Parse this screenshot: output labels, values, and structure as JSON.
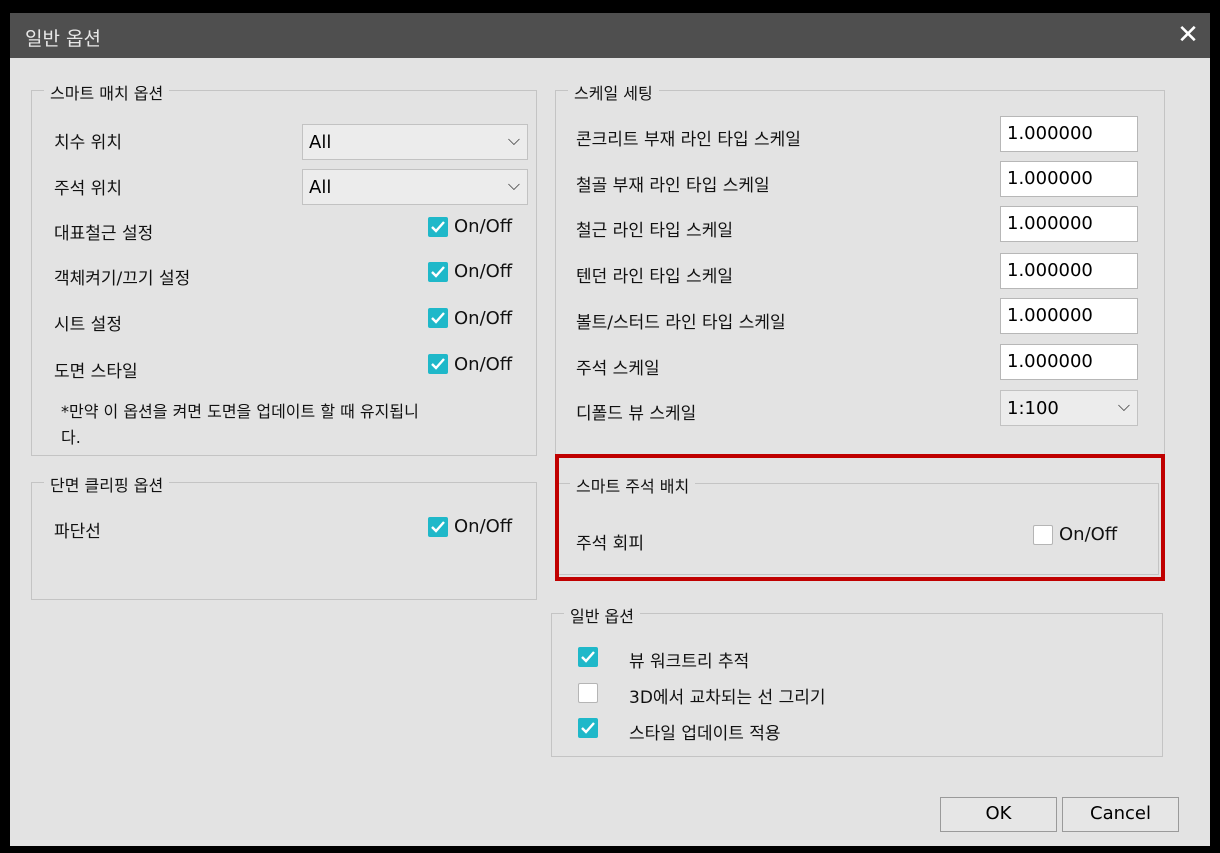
{
  "window": {
    "title": "일반 옵션",
    "close_glyph": "✕"
  },
  "smart_match": {
    "legend": "스마트 매치 옵션",
    "dim_position": {
      "label": "치수 위치",
      "value": "All"
    },
    "note_position": {
      "label": "주석 위치",
      "value": "All"
    },
    "toggles": [
      {
        "label": "대표철근 설정",
        "text": "On/Off",
        "checked": true
      },
      {
        "label": "객체켜기/끄기 설정",
        "text": "On/Off",
        "checked": true
      },
      {
        "label": "시트 설정",
        "text": "On/Off",
        "checked": true
      },
      {
        "label": "도면 스타일",
        "text": "On/Off",
        "checked": true
      }
    ],
    "note_line1": "*만약 이 옵션을 켜면 도면을 업데이트 할 때 유지됩니",
    "note_line2": "다."
  },
  "section_clip": {
    "legend": "단면 클리핑 옵션",
    "toggle": {
      "label": "파단선",
      "text": "On/Off",
      "checked": true
    }
  },
  "scale": {
    "legend": "스케일 세팅",
    "rows": [
      {
        "label": "콘크리트 부재 라인 타입 스케일",
        "value": "1.000000"
      },
      {
        "label": "철골 부재 라인 타입 스케일",
        "value": "1.000000"
      },
      {
        "label": "철근 라인 타입 스케일",
        "value": "1.000000"
      },
      {
        "label": "텐던 라인 타입 스케일",
        "value": "1.000000"
      },
      {
        "label": "볼트/스터드 라인 타입 스케일",
        "value": "1.000000"
      },
      {
        "label": "주석 스케일",
        "value": "1.000000"
      }
    ],
    "default_view": {
      "label": "디폴드 뷰 스케일",
      "value": "1:100"
    }
  },
  "smart_note": {
    "legend": "스마트 주석 배치",
    "toggle": {
      "label": "주석 회피",
      "text": "On/Off",
      "checked": false
    }
  },
  "general": {
    "legend": "일반 옵션",
    "items": [
      {
        "label": "뷰 워크트리 추적",
        "checked": true
      },
      {
        "label": "3D에서 교차되는 선 그리기",
        "checked": false
      },
      {
        "label": "스타일 업데이트 적용",
        "checked": true
      }
    ]
  },
  "buttons": {
    "ok": "OK",
    "cancel": "Cancel"
  },
  "colors": {
    "accent": "#1fb8c9",
    "highlight": "#c00000",
    "titlebar": "#4f4f4f"
  }
}
